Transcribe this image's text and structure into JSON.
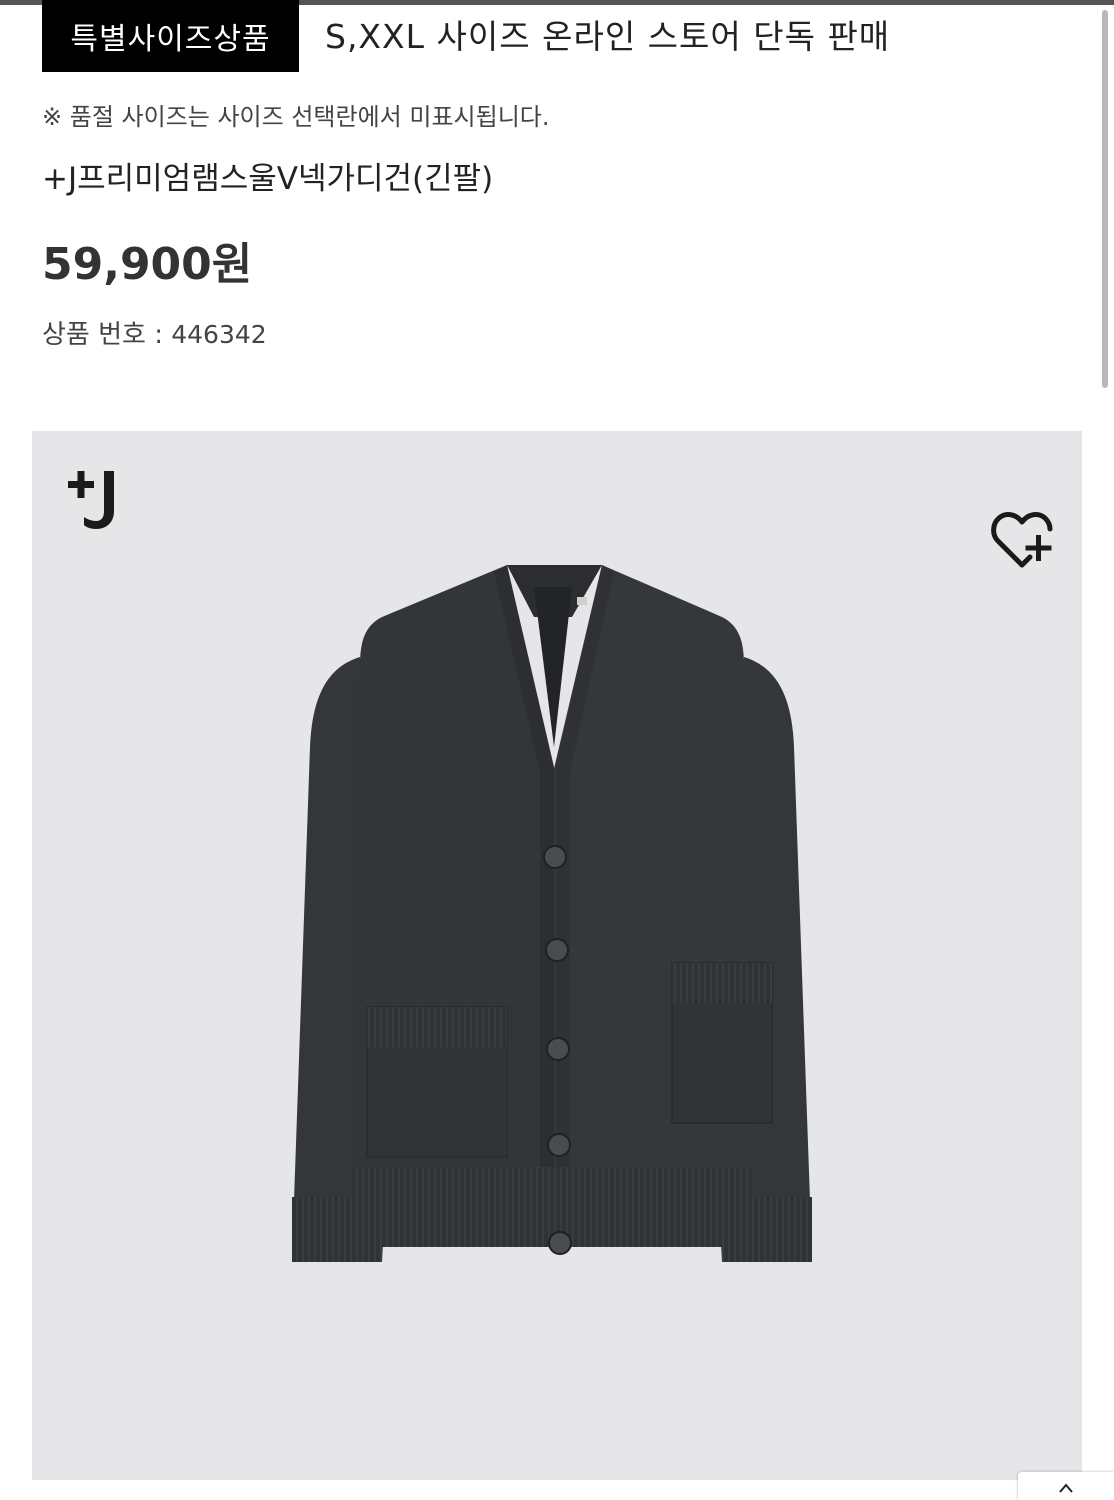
{
  "header": {
    "badge_label": "특별사이즈상품",
    "badge_description": "S,XXL 사이즈 온라인 스토어 단독 판매",
    "soldout_note": "※ 품절 사이즈는 사이즈 선택란에서 미표시됩니다."
  },
  "product": {
    "name": "+J프리미엄램스울V넥가디건(긴팔)",
    "price": "59,900원",
    "code_label": "상품 번호 : ",
    "code_value": "446342"
  },
  "image_panel": {
    "brand_logo_text": "+J",
    "wishlist_icon": "heart-plus-icon",
    "product_image": "dark-charcoal-v-neck-cardigan",
    "background_color": "#e6e6e8"
  },
  "colors": {
    "badge_bg": "#000000",
    "badge_fg": "#ffffff",
    "garment": "#333638"
  }
}
